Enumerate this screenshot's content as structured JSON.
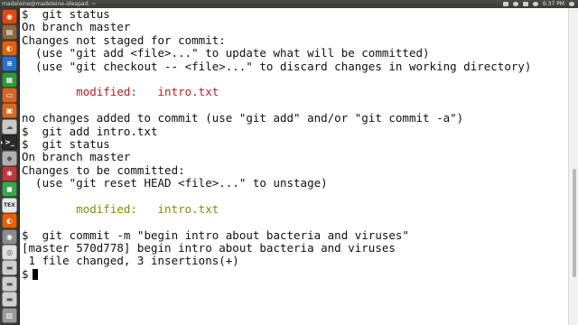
{
  "window": {
    "title": "madeleine@madeleine-ideapad: ~",
    "clock": "6:37 PM"
  },
  "launcher": {
    "items": [
      {
        "name": "ubuntu-dash",
        "color": "#dd4814",
        "glyph": "◉"
      },
      {
        "name": "files",
        "color": "#8c6b43",
        "glyph": "▤"
      },
      {
        "name": "firefox",
        "color": "#e66000",
        "glyph": "◐"
      },
      {
        "name": "libreoffice-writer",
        "color": "#2a72c6",
        "glyph": "≡"
      },
      {
        "name": "libreoffice-calc",
        "color": "#2f9a3a",
        "glyph": "▦"
      },
      {
        "name": "libreoffice-impress",
        "color": "#d5652a",
        "glyph": "▭"
      },
      {
        "name": "software-center",
        "color": "#d86a1f",
        "glyph": "▣"
      },
      {
        "name": "ubuntu-one",
        "color": "#c9c9c9",
        "glyph": "☁"
      },
      {
        "name": "terminal",
        "color": "#2b2b2b",
        "glyph": ">_"
      },
      {
        "name": "synaptic",
        "color": "#b0b0b0",
        "glyph": "◆"
      },
      {
        "name": "app-red",
        "color": "#c33838",
        "glyph": "✱"
      },
      {
        "name": "app-green",
        "color": "#39a84b",
        "glyph": "◼"
      },
      {
        "name": "texmaker",
        "color": "#e8e8e8",
        "glyph": "TEX"
      },
      {
        "name": "firefox-2",
        "color": "#e66000",
        "glyph": "◐"
      },
      {
        "name": "app-grey",
        "color": "#8a8a8a",
        "glyph": "◉"
      },
      {
        "name": "chrome",
        "color": "#e0e0e0",
        "glyph": "◎"
      },
      {
        "name": "drive-1",
        "color": "#cfcfcf",
        "glyph": "▬"
      },
      {
        "name": "drive-2",
        "color": "#cfcfcf",
        "glyph": "▬"
      },
      {
        "name": "drive-3",
        "color": "#cfcfcf",
        "glyph": "▬"
      },
      {
        "name": "trash",
        "color": "#9a9a9a",
        "glyph": "▥"
      }
    ]
  },
  "terminal": {
    "lines": [
      {
        "text": "$  git status",
        "kind": "normal"
      },
      {
        "text": "On branch master",
        "kind": "normal"
      },
      {
        "text": "Changes not staged for commit:",
        "kind": "normal"
      },
      {
        "text": "  (use \"git add <file>...\" to update what will be committed)",
        "kind": "normal"
      },
      {
        "text": "  (use \"git checkout -- <file>...\" to discard changes in working directory)",
        "kind": "normal"
      },
      {
        "text": "",
        "kind": "normal"
      },
      {
        "text": "        modified:   intro.txt",
        "kind": "modified"
      },
      {
        "text": "",
        "kind": "normal"
      },
      {
        "text": "no changes added to commit (use \"git add\" and/or \"git commit -a\")",
        "kind": "normal"
      },
      {
        "text": "$  git add intro.txt",
        "kind": "normal"
      },
      {
        "text": "$  git status",
        "kind": "normal"
      },
      {
        "text": "On branch master",
        "kind": "normal"
      },
      {
        "text": "Changes to be committed:",
        "kind": "normal"
      },
      {
        "text": "  (use \"git reset HEAD <file>...\" to unstage)",
        "kind": "normal"
      },
      {
        "text": "",
        "kind": "normal"
      },
      {
        "text": "        modified:   intro.txt",
        "kind": "staged"
      },
      {
        "text": "",
        "kind": "normal"
      },
      {
        "text": "$  git commit -m \"begin intro about bacteria and viruses\"",
        "kind": "normal"
      },
      {
        "text": "[master 570d778] begin intro about bacteria and viruses",
        "kind": "normal"
      },
      {
        "text": " 1 file changed, 3 insertions(+)",
        "kind": "normal"
      }
    ],
    "prompt": "$"
  }
}
